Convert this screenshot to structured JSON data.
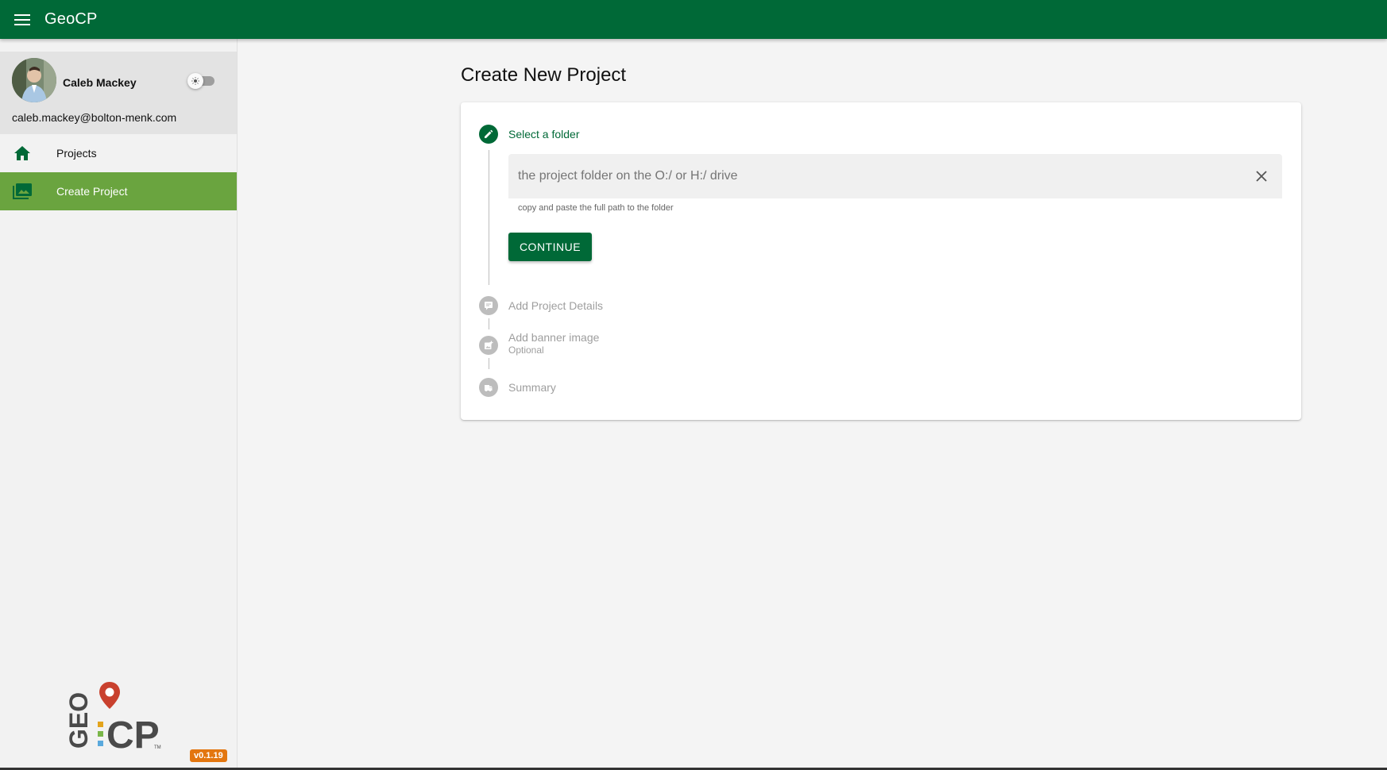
{
  "app": {
    "title": "GeoCP",
    "brand_color": "#006937",
    "accent_color": "#6aa43f",
    "menu_icon": "hamburger-menu-icon"
  },
  "sidebar": {
    "user": {
      "name": "Caleb Mackey",
      "email": "caleb.mackey@bolton-menk.com"
    },
    "theme_toggle": {
      "on": false,
      "icon": "sun-icon"
    },
    "items": [
      {
        "label": "Projects",
        "icon": "home-icon",
        "active": false
      },
      {
        "label": "Create Project",
        "icon": "photo-library-icon",
        "active": true
      }
    ],
    "logo_trademark": "TM",
    "version": "v0.1.19"
  },
  "main": {
    "title": "Create New Project",
    "stepper": {
      "steps": [
        {
          "label": "Select a folder",
          "icon": "pencil-icon",
          "state": "active"
        },
        {
          "label": "Add Project Details",
          "icon": "details-icon",
          "state": "inactive"
        },
        {
          "label": "Add banner image",
          "sublabel": "Optional",
          "icon": "add-image-icon",
          "state": "inactive"
        },
        {
          "label": "Summary",
          "icon": "summary-icon",
          "state": "inactive"
        }
      ]
    },
    "folder_field": {
      "value": "",
      "placeholder": "the project folder on the O:/ or H:/ drive",
      "hint": "copy and paste the full path to the folder"
    },
    "continue_label": "CONTINUE"
  }
}
